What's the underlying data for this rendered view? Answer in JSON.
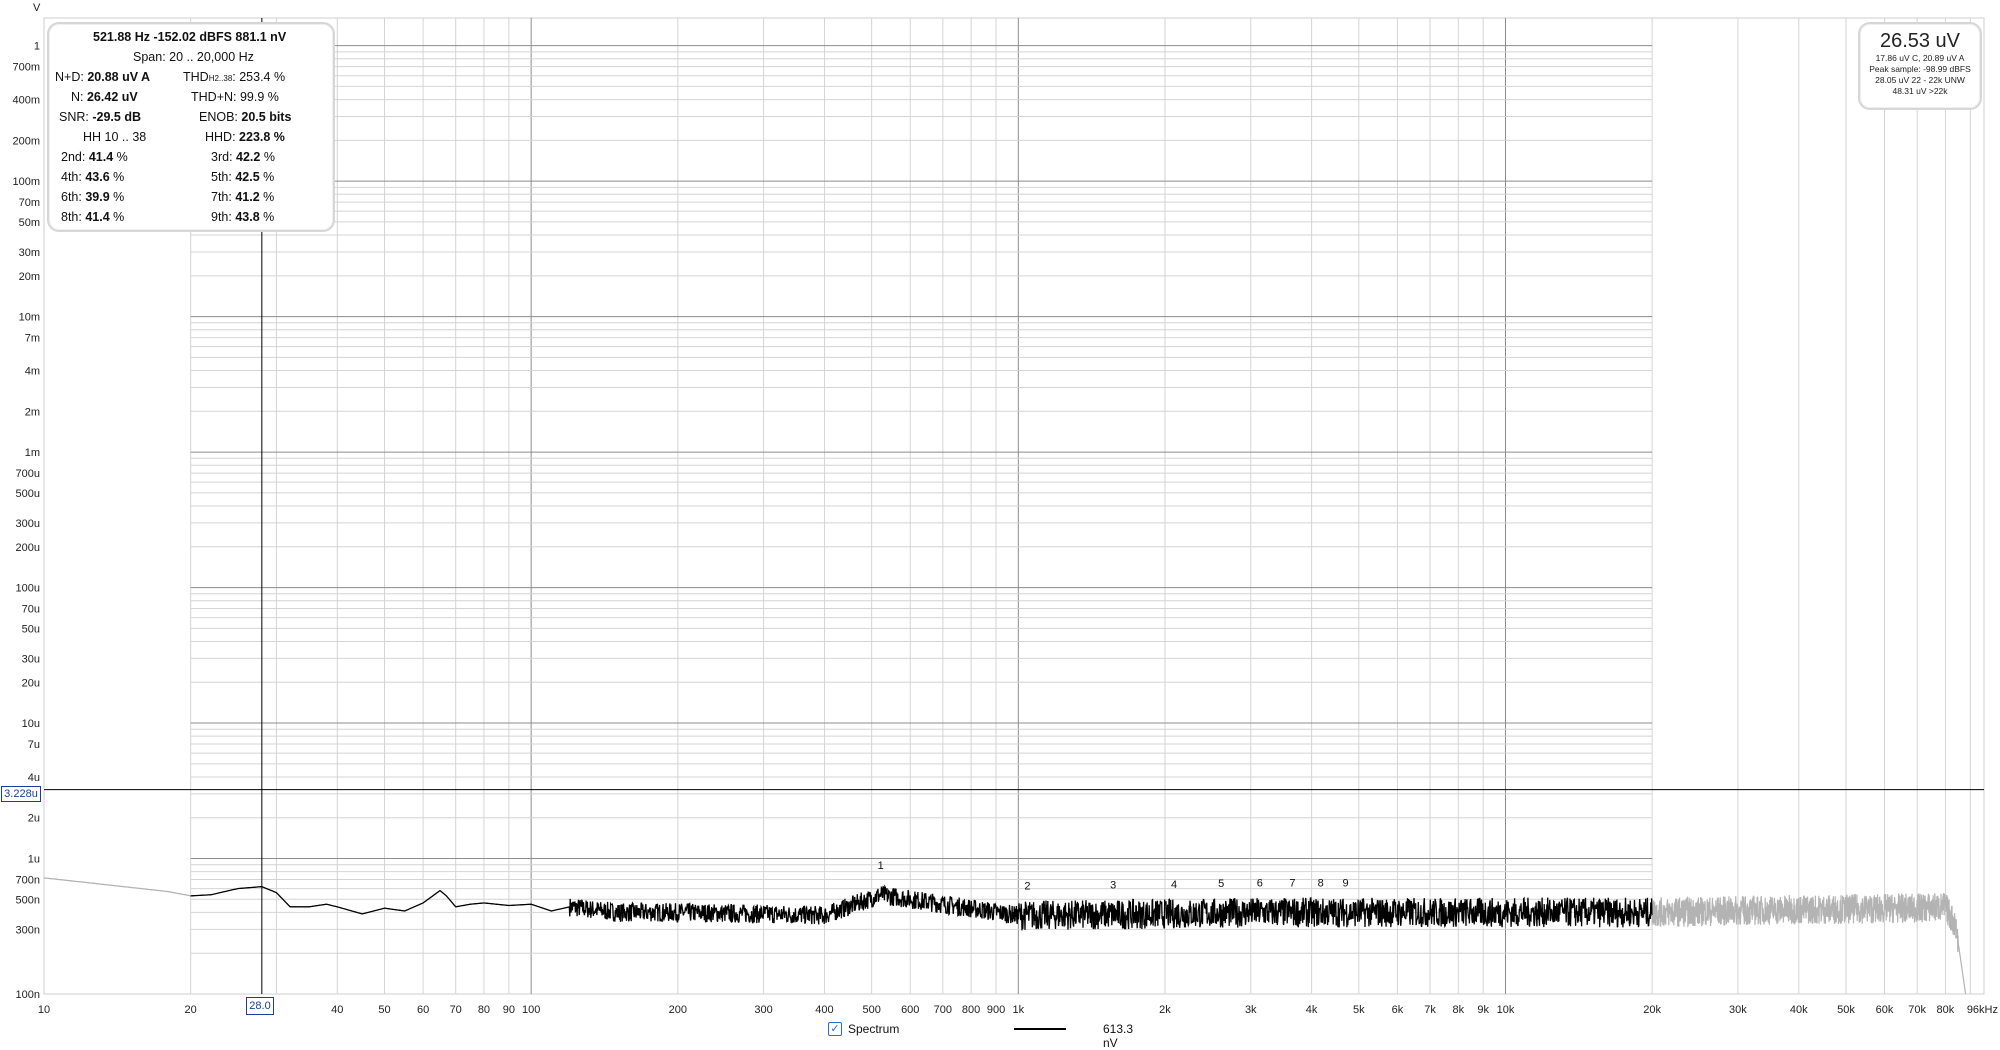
{
  "units_label": "V",
  "chart_data": {
    "type": "line",
    "title": "",
    "xlabel": "",
    "ylabel": "V",
    "x_scale": "log",
    "y_scale": "log",
    "xlim": [
      10,
      96000
    ],
    "ylim": [
      1e-07,
      1.6
    ],
    "grid": true,
    "x_ticks": [
      {
        "v": 10,
        "t": "10"
      },
      {
        "v": 20,
        "t": "20"
      },
      {
        "v": 40,
        "t": "40"
      },
      {
        "v": 50,
        "t": "50"
      },
      {
        "v": 60,
        "t": "60"
      },
      {
        "v": 70,
        "t": "70"
      },
      {
        "v": 80,
        "t": "80"
      },
      {
        "v": 90,
        "t": "90"
      },
      {
        "v": 100,
        "t": "100"
      },
      {
        "v": 200,
        "t": "200"
      },
      {
        "v": 300,
        "t": "300"
      },
      {
        "v": 400,
        "t": "400"
      },
      {
        "v": 500,
        "t": "500"
      },
      {
        "v": 600,
        "t": "600"
      },
      {
        "v": 700,
        "t": "700"
      },
      {
        "v": 800,
        "t": "800"
      },
      {
        "v": 900,
        "t": "900"
      },
      {
        "v": 1000,
        "t": "1k"
      },
      {
        "v": 2000,
        "t": "2k"
      },
      {
        "v": 3000,
        "t": "3k"
      },
      {
        "v": 4000,
        "t": "4k"
      },
      {
        "v": 5000,
        "t": "5k"
      },
      {
        "v": 6000,
        "t": "6k"
      },
      {
        "v": 7000,
        "t": "7k"
      },
      {
        "v": 8000,
        "t": "8k"
      },
      {
        "v": 9000,
        "t": "9k"
      },
      {
        "v": 10000,
        "t": "10k"
      },
      {
        "v": 20000,
        "t": "20k"
      },
      {
        "v": 30000,
        "t": "30k"
      },
      {
        "v": 40000,
        "t": "40k"
      },
      {
        "v": 50000,
        "t": "50k"
      },
      {
        "v": 60000,
        "t": "60k"
      },
      {
        "v": 70000,
        "t": "70k"
      },
      {
        "v": 80000,
        "t": "80k"
      },
      {
        "v": 96000,
        "t": "96kHz"
      }
    ],
    "y_ticks": [
      {
        "v": 1,
        "t": "1"
      },
      {
        "v": 0.7,
        "t": "700m"
      },
      {
        "v": 0.4,
        "t": "400m"
      },
      {
        "v": 0.2,
        "t": "200m"
      },
      {
        "v": 0.1,
        "t": "100m"
      },
      {
        "v": 0.07,
        "t": "70m"
      },
      {
        "v": 0.05,
        "t": "50m"
      },
      {
        "v": 0.03,
        "t": "30m"
      },
      {
        "v": 0.02,
        "t": "20m"
      },
      {
        "v": 0.01,
        "t": "10m"
      },
      {
        "v": 0.007,
        "t": "7m"
      },
      {
        "v": 0.004,
        "t": "4m"
      },
      {
        "v": 0.002,
        "t": "2m"
      },
      {
        "v": 0.001,
        "t": "1m"
      },
      {
        "v": 0.0007,
        "t": "700u"
      },
      {
        "v": 0.0005,
        "t": "500u"
      },
      {
        "v": 0.0003,
        "t": "300u"
      },
      {
        "v": 0.0002,
        "t": "200u"
      },
      {
        "v": 0.0001,
        "t": "100u"
      },
      {
        "v": 7e-05,
        "t": "70u"
      },
      {
        "v": 5e-05,
        "t": "50u"
      },
      {
        "v": 3e-05,
        "t": "30u"
      },
      {
        "v": 2e-05,
        "t": "20u"
      },
      {
        "v": 1e-05,
        "t": "10u"
      },
      {
        "v": 7e-06,
        "t": "7u"
      },
      {
        "v": 4e-06,
        "t": "4u"
      },
      {
        "v": 2e-06,
        "t": "2u"
      },
      {
        "v": 1e-06,
        "t": "1u"
      },
      {
        "v": 7e-07,
        "t": "700n"
      },
      {
        "v": 5e-07,
        "t": "500n"
      },
      {
        "v": 3e-07,
        "t": "300n"
      },
      {
        "v": 1e-07,
        "t": "100n"
      }
    ],
    "series": [
      {
        "name": "Spectrum",
        "color": "#000000",
        "out_of_span_color": "#b3b3b3",
        "span_hz": [
          20,
          20000
        ],
        "x": [
          10,
          14,
          18,
          20,
          22,
          25,
          28,
          30,
          32,
          35,
          38,
          40,
          45,
          50,
          55,
          60,
          65,
          67,
          70,
          75,
          80,
          90,
          100,
          110,
          120,
          150,
          200,
          300,
          400,
          521.88,
          1000,
          2000,
          3000,
          5000,
          10000,
          20000,
          40000,
          70000,
          80000,
          84000,
          88000
        ],
        "y": [
          7.2e-07,
          6.3e-07,
          5.7e-07,
          5.3e-07,
          5.4e-07,
          6e-07,
          6.2e-07,
          5.6e-07,
          4.4e-07,
          4.4e-07,
          4.6e-07,
          4.4e-07,
          3.9e-07,
          4.3e-07,
          4.1e-07,
          4.7e-07,
          5.8e-07,
          5.3e-07,
          4.4e-07,
          4.6e-07,
          4.7e-07,
          4.5e-07,
          4.6e-07,
          4.1e-07,
          4.4e-07,
          4e-07,
          4e-07,
          3.9e-07,
          3.8e-07,
          5.4e-07,
          3.8e-07,
          3.9e-07,
          4e-07,
          4e-07,
          4e-07,
          4e-07,
          4.2e-07,
          4.3e-07,
          4.4e-07,
          3.2e-07,
          1e-07
        ]
      }
    ],
    "harmonic_markers": [
      {
        "t": "1",
        "x": 521.88
      },
      {
        "t": "2",
        "x": 1043.8
      },
      {
        "t": "3",
        "x": 1565.6
      },
      {
        "t": "4",
        "x": 2087.5
      },
      {
        "t": "5",
        "x": 2609.4
      },
      {
        "t": "6",
        "x": 3131.3
      },
      {
        "t": "7",
        "x": 3653.2
      },
      {
        "t": "8",
        "x": 4175
      },
      {
        "t": "9",
        "x": 4696.9
      }
    ],
    "cursor": {
      "x": 28.0,
      "y": 3.228e-06,
      "x_label": "28.0",
      "y_label": "3.228u"
    }
  },
  "stats": {
    "header": "521.88 Hz  -152.02 dBFS  881.1 nV",
    "span": "Span: 20 .. 20,000 Hz",
    "nd_label": "N+D:",
    "nd_value": "20.88 uV A",
    "thd_label": "THD",
    "thd_sub": "H2..38",
    "thd_value": ": 253.4 %",
    "n_label": "N:",
    "n_value": "26.42 uV",
    "thdn_label": "THD+N:",
    "thdn_value": "99.9 %",
    "snr_label": "SNR:",
    "snr_value": "-29.5 dB",
    "enob_label": "ENOB:",
    "enob_value": "20.5 bits",
    "hh_label": "HH 10 .. 38",
    "hhd_label": "HHD:",
    "hhd_value": "223.8 %",
    "harmonics": [
      {
        "label": "2nd:",
        "value": "41.4",
        "unit": " %"
      },
      {
        "label": "3rd:",
        "value": "42.2",
        "unit": " %"
      },
      {
        "label": "4th:",
        "value": "43.6",
        "unit": " %"
      },
      {
        "label": "5th:",
        "value": "42.5",
        "unit": " %"
      },
      {
        "label": "6th:",
        "value": "39.9",
        "unit": " %"
      },
      {
        "label": "7th:",
        "value": "41.2",
        "unit": " %"
      },
      {
        "label": "8th:",
        "value": "41.4",
        "unit": " %"
      },
      {
        "label": "9th:",
        "value": "43.8",
        "unit": " %"
      }
    ]
  },
  "level": {
    "big": "26.53 uV",
    "line1": "17.86 uV C, 20.89 uV A",
    "line2": "Peak sample: -98.99 dBFS",
    "line3": "28.05 uV 22 - 22k UNW",
    "line4": "48.31 uV >22k"
  },
  "legend": {
    "checkbox_checked": true,
    "label": "Spectrum",
    "value": "613.3 nV"
  }
}
